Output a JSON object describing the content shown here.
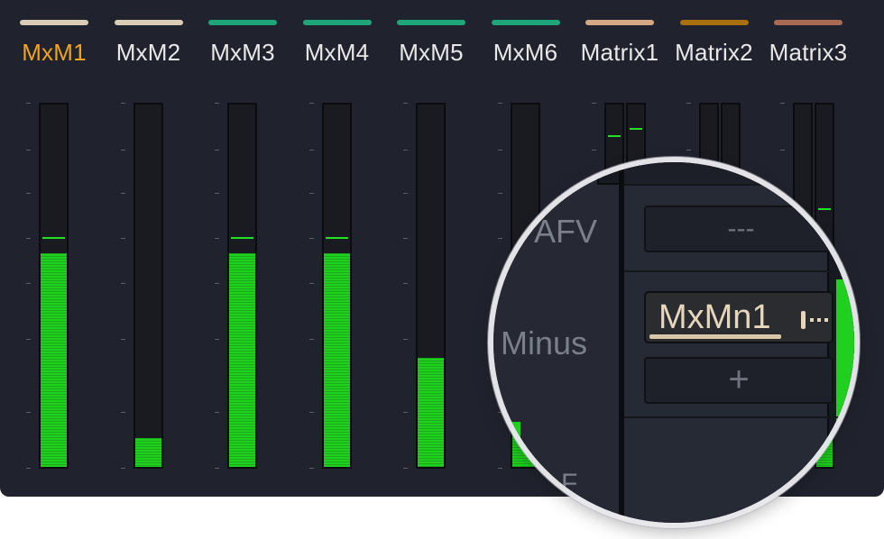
{
  "channels": [
    {
      "label": "MxM1",
      "color": "#d9cdb8",
      "active": true,
      "meters": [
        {
          "level": 0.59,
          "peak": 0.63
        }
      ]
    },
    {
      "label": "MxM2",
      "color": "#d9cdb8",
      "active": false,
      "meters": [
        {
          "level": 0.08,
          "peak": null
        }
      ]
    },
    {
      "label": "MxM3",
      "color": "#1fa57a",
      "active": false,
      "meters": [
        {
          "level": 0.59,
          "peak": 0.63
        }
      ]
    },
    {
      "label": "MxM4",
      "color": "#1fa57a",
      "active": false,
      "meters": [
        {
          "level": 0.59,
          "peak": 0.63
        }
      ]
    },
    {
      "label": "MxM5",
      "color": "#1fa57a",
      "active": false,
      "meters": [
        {
          "level": 0.3,
          "peak": null
        }
      ]
    },
    {
      "label": "MxM6",
      "color": "#1fa57a",
      "active": false,
      "meters": [
        {
          "level": 0.13,
          "peak": null
        }
      ]
    },
    {
      "label": "Matrix1",
      "color": "#d4a882",
      "active": false,
      "meters": [
        {
          "level": 0.0,
          "peak": 0.91
        },
        {
          "level": 0.0,
          "peak": 0.93
        }
      ]
    },
    {
      "label": "Matrix2",
      "color": "#a8700f",
      "active": false,
      "meters": [
        {
          "level": 0.0,
          "peak": null
        },
        {
          "level": 0.0,
          "peak": null
        }
      ]
    },
    {
      "label": "Matrix3",
      "color": "#a86a55",
      "active": false,
      "meters": [
        {
          "level": 0.69,
          "peak": 0.69
        },
        {
          "level": 0.52,
          "peak": 0.71
        }
      ]
    }
  ],
  "magnifier": {
    "afv_label": "AFV",
    "afv_value": "---",
    "minus_label": "Minus",
    "minus_value": "MxMn1",
    "add_label": "+",
    "partial_label": "F"
  }
}
